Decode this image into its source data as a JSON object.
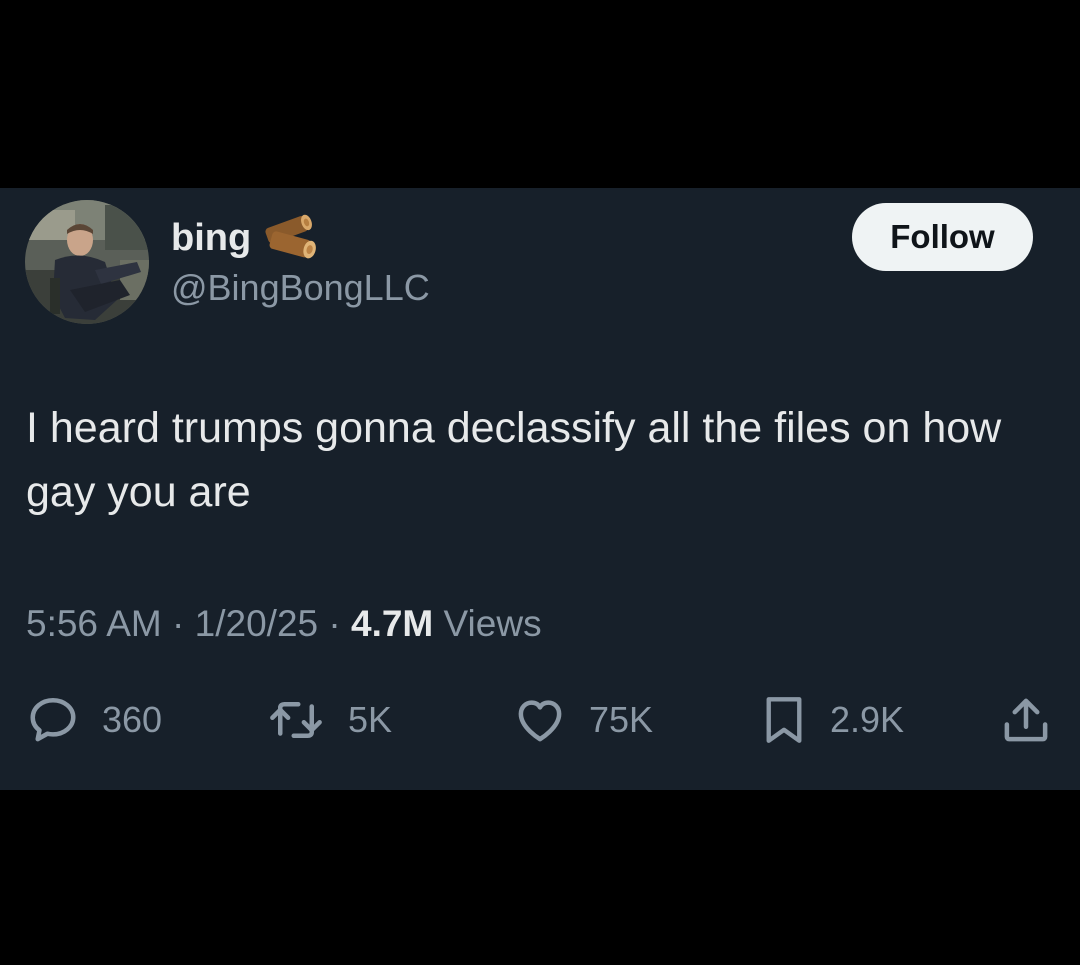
{
  "colors": {
    "background": "#000000",
    "card": "#17202a",
    "primary_text": "#e7e9ea",
    "secondary_text": "#8b98a5",
    "follow_button_bg": "#eff3f4",
    "follow_button_text": "#0f1419"
  },
  "author": {
    "display_name": "bing",
    "badge_icon": "wood-log-emoji",
    "handle": "@BingBongLLC",
    "avatar": "profile-photo"
  },
  "follow_button": {
    "label": "Follow"
  },
  "tweet": {
    "text": "I heard trumps gonna declassify all the files on how gay you are",
    "time": "5:56 AM",
    "date": "1/20/25",
    "separator": "·",
    "views_count": "4.7M",
    "views_label": "Views"
  },
  "actions": {
    "reply": {
      "icon": "reply-bubble-icon",
      "count": "360"
    },
    "retweet": {
      "icon": "retweet-icon",
      "count": "5K"
    },
    "like": {
      "icon": "heart-icon",
      "count": "75K"
    },
    "bookmark": {
      "icon": "bookmark-icon",
      "count": "2.9K"
    },
    "share": {
      "icon": "share-icon"
    }
  }
}
